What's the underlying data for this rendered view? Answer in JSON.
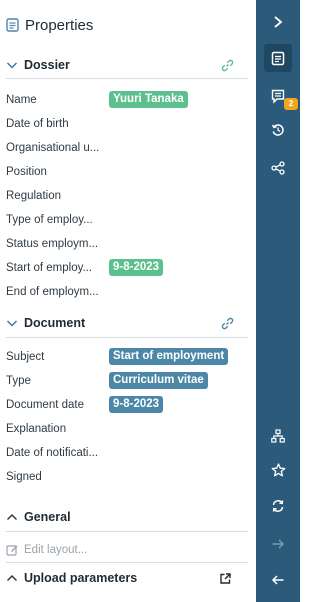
{
  "header": {
    "title": "Properties"
  },
  "sections": {
    "dossier": {
      "title": "Dossier",
      "fields": [
        {
          "label": "Name",
          "value": "Yuuri Tanaka"
        },
        {
          "label": "Date of birth",
          "value": ""
        },
        {
          "label": "Organisational u...",
          "value": ""
        },
        {
          "label": "Position",
          "value": ""
        },
        {
          "label": "Regulation",
          "value": ""
        },
        {
          "label": "Type of employ...",
          "value": ""
        },
        {
          "label": "Status employm...",
          "value": ""
        },
        {
          "label": "Start of employ...",
          "value": "9-8-2023"
        },
        {
          "label": "End of employm...",
          "value": ""
        }
      ]
    },
    "document": {
      "title": "Document",
      "fields": [
        {
          "label": "Subject",
          "value": "Start of employment"
        },
        {
          "label": "Type",
          "value": "Curriculum vitae"
        },
        {
          "label": "Document date",
          "value": "9-8-2023"
        },
        {
          "label": "Explanation",
          "value": ""
        },
        {
          "label": "Date of notificati...",
          "value": ""
        },
        {
          "label": "Signed",
          "value": ""
        }
      ]
    },
    "general": {
      "title": "General",
      "edit_layout": "Edit layout..."
    },
    "upload": {
      "title": "Upload parameters"
    }
  },
  "rail": {
    "notes_badge": "2"
  },
  "colors": {
    "rail": "#2b5a7a",
    "chip_green": "#5cbf8e",
    "chip_blue": "#4d87a8",
    "badge": "#f3a51d"
  }
}
